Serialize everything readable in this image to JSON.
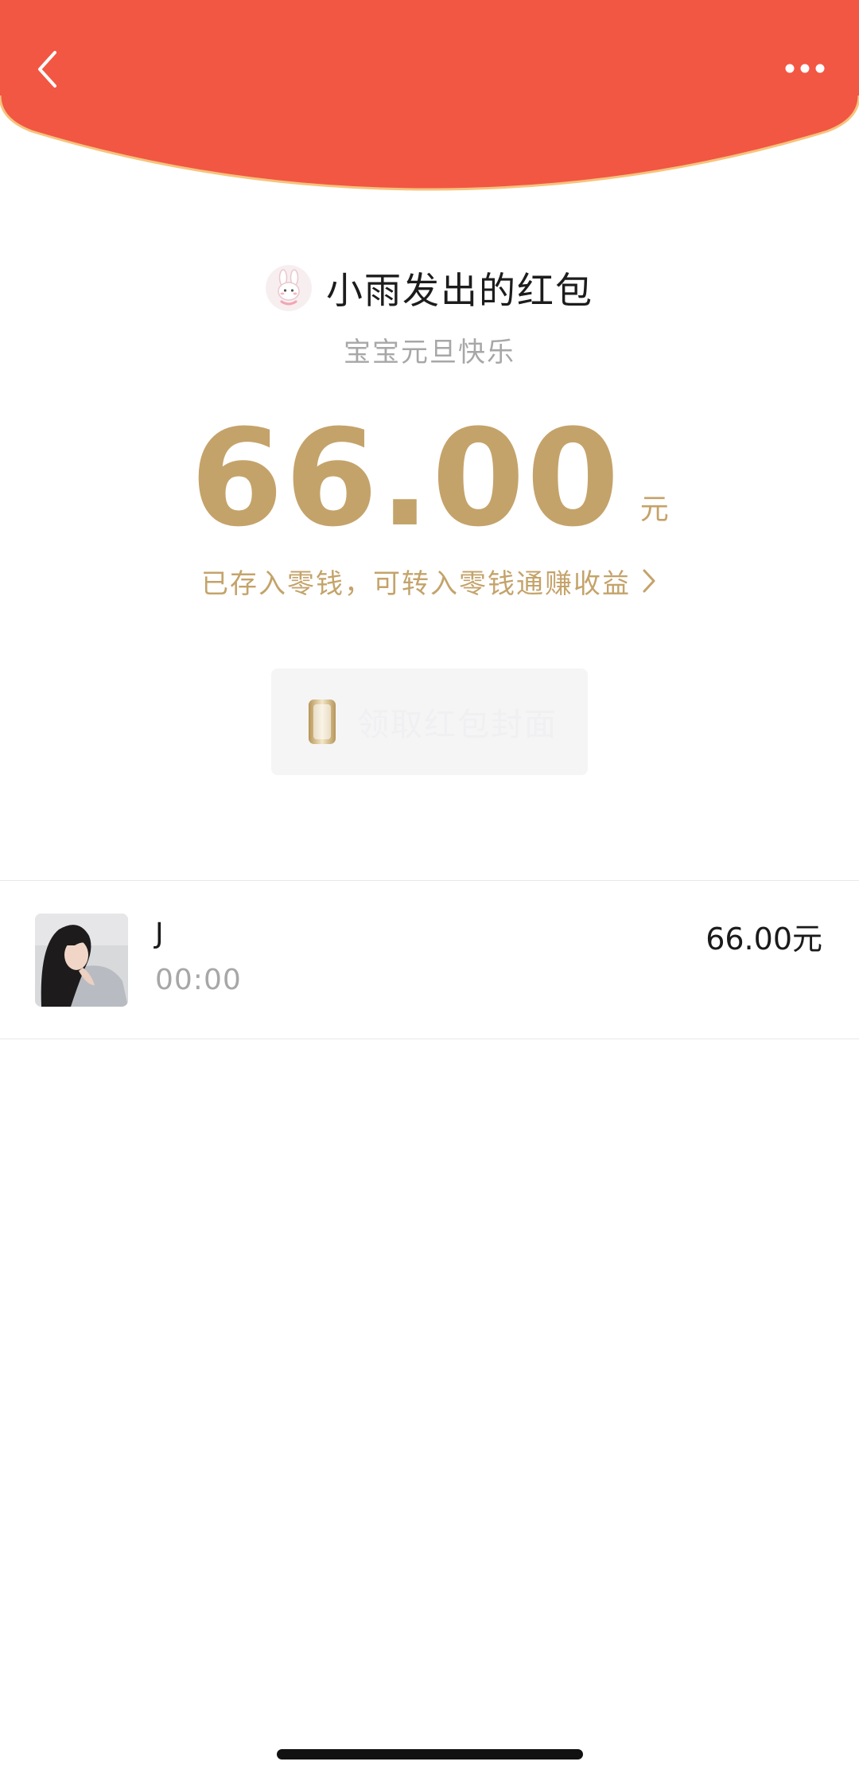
{
  "header": {
    "back_icon": "chevron-left-icon",
    "more_icon": "more-dots-icon",
    "bg_color": "#f25743",
    "edge_color": "#f6c37c"
  },
  "packet": {
    "sender_avatar_icon": "bunny-avatar-icon",
    "sender_title": "小雨发出的红包",
    "blessing": "宝宝元旦快乐",
    "amount": "66.00",
    "unit": "元",
    "deposit_text": "已存入零钱，可转入零钱通赚收益",
    "accent_color": "#c4a36a"
  },
  "cover_card": {
    "icon": "red-packet-cover-icon",
    "label": "领取红包封面"
  },
  "receivers": [
    {
      "name": "J",
      "time": "00:00",
      "amount": "66.00元"
    }
  ]
}
